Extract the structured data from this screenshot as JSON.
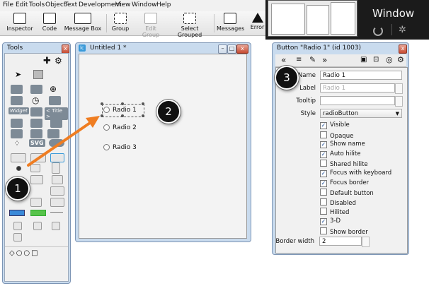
{
  "menubar": [
    "File",
    "Edit",
    "Tools",
    "Object",
    "Text",
    "Development",
    "View",
    "Window",
    "Help"
  ],
  "toolbar": [
    {
      "label": "Inspector",
      "icon": "inspector-icon",
      "enabled": true
    },
    {
      "label": "Code",
      "icon": "code-icon",
      "enabled": true
    },
    {
      "label": "Message Box",
      "icon": "message-box-icon",
      "enabled": true
    },
    {
      "label": "Group",
      "icon": "group-icon",
      "enabled": true
    },
    {
      "label": "Edit Group",
      "icon": "edit-group-icon",
      "enabled": false
    },
    {
      "label": "Select Grouped",
      "icon": "select-grouped-icon",
      "enabled": true
    },
    {
      "label": "Messages",
      "icon": "messages-icon",
      "enabled": true
    },
    {
      "label": "Error",
      "icon": "error-icon",
      "enabled": true
    }
  ],
  "desktop": {
    "window_label": "Window"
  },
  "tools_palette": {
    "title": "Tools",
    "widget_label": "Widget",
    "svg_label": "SVG",
    "title_label": "< Title >"
  },
  "stack_window": {
    "title": "Untitled 1 *",
    "radios": [
      "Radio 1",
      "Radio 2",
      "Radio 3"
    ]
  },
  "inspector": {
    "title": "Button \"Radio 1\" (id 1003)",
    "fields": {
      "name": {
        "label": "Name",
        "value": "Radio 1"
      },
      "label": {
        "label": "Label",
        "value": "Radio 1"
      },
      "tooltip": {
        "label": "Tooltip",
        "value": ""
      },
      "style": {
        "label": "Style",
        "value": "radioButton"
      }
    },
    "checkboxes": [
      {
        "label": "Visible",
        "checked": true
      },
      {
        "label": "Opaque",
        "checked": false
      },
      {
        "label": "Show name",
        "checked": true
      },
      {
        "label": "Auto hilite",
        "checked": true
      },
      {
        "label": "Shared hilite",
        "checked": false
      },
      {
        "label": "Focus with keyboard",
        "checked": true
      },
      {
        "label": "Focus border",
        "checked": true
      },
      {
        "label": "Default button",
        "checked": false
      },
      {
        "label": "Disabled",
        "checked": false
      },
      {
        "label": "Hilited",
        "checked": false
      },
      {
        "label": "3-D",
        "checked": true
      },
      {
        "label": "Show border",
        "checked": false
      }
    ],
    "border_width": {
      "label": "Border width",
      "value": "2"
    }
  },
  "callouts": [
    "1",
    "2",
    "3"
  ],
  "colors": {
    "arrow": "#ef7d22",
    "window_frame": "#c9dbee",
    "close": "#c64b32"
  }
}
